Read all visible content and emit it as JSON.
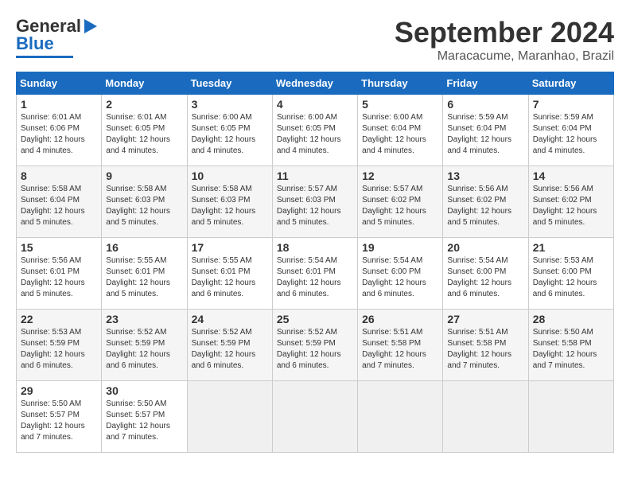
{
  "logo": {
    "line1": "General",
    "line2": "Blue"
  },
  "header": {
    "month": "September 2024",
    "location": "Maracacume, Maranhao, Brazil"
  },
  "days_of_week": [
    "Sunday",
    "Monday",
    "Tuesday",
    "Wednesday",
    "Thursday",
    "Friday",
    "Saturday"
  ],
  "weeks": [
    [
      {
        "day": "1",
        "info": "Sunrise: 6:01 AM\nSunset: 6:06 PM\nDaylight: 12 hours\nand 4 minutes."
      },
      {
        "day": "2",
        "info": "Sunrise: 6:01 AM\nSunset: 6:05 PM\nDaylight: 12 hours\nand 4 minutes."
      },
      {
        "day": "3",
        "info": "Sunrise: 6:00 AM\nSunset: 6:05 PM\nDaylight: 12 hours\nand 4 minutes."
      },
      {
        "day": "4",
        "info": "Sunrise: 6:00 AM\nSunset: 6:05 PM\nDaylight: 12 hours\nand 4 minutes."
      },
      {
        "day": "5",
        "info": "Sunrise: 6:00 AM\nSunset: 6:04 PM\nDaylight: 12 hours\nand 4 minutes."
      },
      {
        "day": "6",
        "info": "Sunrise: 5:59 AM\nSunset: 6:04 PM\nDaylight: 12 hours\nand 4 minutes."
      },
      {
        "day": "7",
        "info": "Sunrise: 5:59 AM\nSunset: 6:04 PM\nDaylight: 12 hours\nand 4 minutes."
      }
    ],
    [
      {
        "day": "8",
        "info": "Sunrise: 5:58 AM\nSunset: 6:04 PM\nDaylight: 12 hours\nand 5 minutes."
      },
      {
        "day": "9",
        "info": "Sunrise: 5:58 AM\nSunset: 6:03 PM\nDaylight: 12 hours\nand 5 minutes."
      },
      {
        "day": "10",
        "info": "Sunrise: 5:58 AM\nSunset: 6:03 PM\nDaylight: 12 hours\nand 5 minutes."
      },
      {
        "day": "11",
        "info": "Sunrise: 5:57 AM\nSunset: 6:03 PM\nDaylight: 12 hours\nand 5 minutes."
      },
      {
        "day": "12",
        "info": "Sunrise: 5:57 AM\nSunset: 6:02 PM\nDaylight: 12 hours\nand 5 minutes."
      },
      {
        "day": "13",
        "info": "Sunrise: 5:56 AM\nSunset: 6:02 PM\nDaylight: 12 hours\nand 5 minutes."
      },
      {
        "day": "14",
        "info": "Sunrise: 5:56 AM\nSunset: 6:02 PM\nDaylight: 12 hours\nand 5 minutes."
      }
    ],
    [
      {
        "day": "15",
        "info": "Sunrise: 5:56 AM\nSunset: 6:01 PM\nDaylight: 12 hours\nand 5 minutes."
      },
      {
        "day": "16",
        "info": "Sunrise: 5:55 AM\nSunset: 6:01 PM\nDaylight: 12 hours\nand 5 minutes."
      },
      {
        "day": "17",
        "info": "Sunrise: 5:55 AM\nSunset: 6:01 PM\nDaylight: 12 hours\nand 6 minutes."
      },
      {
        "day": "18",
        "info": "Sunrise: 5:54 AM\nSunset: 6:01 PM\nDaylight: 12 hours\nand 6 minutes."
      },
      {
        "day": "19",
        "info": "Sunrise: 5:54 AM\nSunset: 6:00 PM\nDaylight: 12 hours\nand 6 minutes."
      },
      {
        "day": "20",
        "info": "Sunrise: 5:54 AM\nSunset: 6:00 PM\nDaylight: 12 hours\nand 6 minutes."
      },
      {
        "day": "21",
        "info": "Sunrise: 5:53 AM\nSunset: 6:00 PM\nDaylight: 12 hours\nand 6 minutes."
      }
    ],
    [
      {
        "day": "22",
        "info": "Sunrise: 5:53 AM\nSunset: 5:59 PM\nDaylight: 12 hours\nand 6 minutes."
      },
      {
        "day": "23",
        "info": "Sunrise: 5:52 AM\nSunset: 5:59 PM\nDaylight: 12 hours\nand 6 minutes."
      },
      {
        "day": "24",
        "info": "Sunrise: 5:52 AM\nSunset: 5:59 PM\nDaylight: 12 hours\nand 6 minutes."
      },
      {
        "day": "25",
        "info": "Sunrise: 5:52 AM\nSunset: 5:59 PM\nDaylight: 12 hours\nand 6 minutes."
      },
      {
        "day": "26",
        "info": "Sunrise: 5:51 AM\nSunset: 5:58 PM\nDaylight: 12 hours\nand 7 minutes."
      },
      {
        "day": "27",
        "info": "Sunrise: 5:51 AM\nSunset: 5:58 PM\nDaylight: 12 hours\nand 7 minutes."
      },
      {
        "day": "28",
        "info": "Sunrise: 5:50 AM\nSunset: 5:58 PM\nDaylight: 12 hours\nand 7 minutes."
      }
    ],
    [
      {
        "day": "29",
        "info": "Sunrise: 5:50 AM\nSunset: 5:57 PM\nDaylight: 12 hours\nand 7 minutes."
      },
      {
        "day": "30",
        "info": "Sunrise: 5:50 AM\nSunset: 5:57 PM\nDaylight: 12 hours\nand 7 minutes."
      },
      {
        "day": "",
        "info": ""
      },
      {
        "day": "",
        "info": ""
      },
      {
        "day": "",
        "info": ""
      },
      {
        "day": "",
        "info": ""
      },
      {
        "day": "",
        "info": ""
      }
    ]
  ]
}
